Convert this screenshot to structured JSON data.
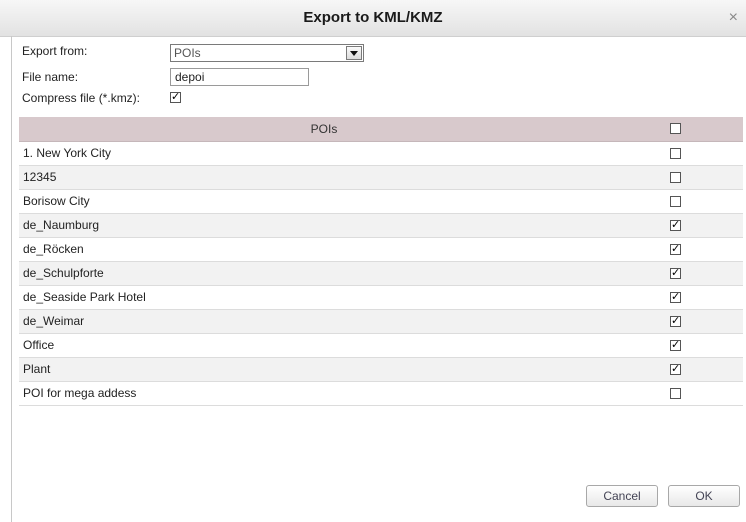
{
  "dialog": {
    "title": "Export to KML/KMZ",
    "close_glyph": "×"
  },
  "form": {
    "export_from_label": "Export from:",
    "export_from_value": "POIs",
    "file_name_label": "File name:",
    "file_name_value": "depoi",
    "compress_label": "Compress file (*.kmz):",
    "compress_checked": true
  },
  "table": {
    "header": "POIs",
    "header_checked": false,
    "rows": [
      {
        "name": "1. New York City",
        "checked": false
      },
      {
        "name": "12345",
        "checked": false
      },
      {
        "name": "Borisow City",
        "checked": false
      },
      {
        "name": "de_Naumburg",
        "checked": true
      },
      {
        "name": "de_Röcken",
        "checked": true
      },
      {
        "name": "de_Schulpforte",
        "checked": true
      },
      {
        "name": "de_Seaside Park Hotel",
        "checked": true
      },
      {
        "name": "de_Weimar",
        "checked": true
      },
      {
        "name": "Office",
        "checked": true
      },
      {
        "name": "Plant",
        "checked": true
      },
      {
        "name": "POI for mega addess",
        "checked": false
      }
    ]
  },
  "buttons": {
    "cancel": "Cancel",
    "ok": "OK"
  }
}
